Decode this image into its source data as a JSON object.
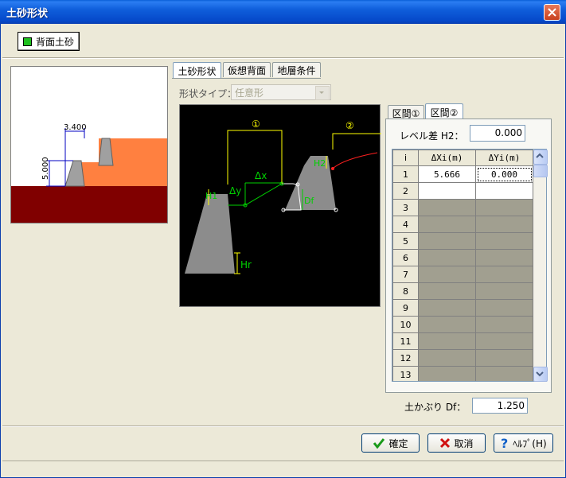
{
  "window": {
    "title": "土砂形状"
  },
  "layer_button": {
    "label": "背面土砂",
    "color": "#1ec01e"
  },
  "preview": {
    "dim_width": "3.400",
    "dim_height": "5.000"
  },
  "tabs": [
    {
      "label": "土砂形状",
      "active": true
    },
    {
      "label": "仮想背面",
      "active": false
    },
    {
      "label": "地層条件",
      "active": false
    }
  ],
  "shape_type": {
    "label": "形状タイプ：",
    "value": "任意形"
  },
  "diagram": {
    "section1": "①",
    "section2": "②",
    "dx": "Δx",
    "dy": "Δy",
    "h1": "H1",
    "h2": "H2",
    "df": "Df",
    "hr": "Hr"
  },
  "section_tabs": [
    {
      "label": "区間①",
      "active": false
    },
    {
      "label": "区間②",
      "active": true
    }
  ],
  "level_diff": {
    "label": "レベル差 H2：",
    "value": "0.000"
  },
  "table": {
    "headers": [
      "i",
      "ΔXi(m)",
      "ΔYi(m)"
    ],
    "rows": [
      {
        "i": "1",
        "dx": "5.666",
        "dy": "0.000"
      },
      {
        "i": "2",
        "dx": "",
        "dy": ""
      },
      {
        "i": "3",
        "dx": "",
        "dy": ""
      },
      {
        "i": "4",
        "dx": "",
        "dy": ""
      },
      {
        "i": "5",
        "dx": "",
        "dy": ""
      },
      {
        "i": "6",
        "dx": "",
        "dy": ""
      },
      {
        "i": "7",
        "dx": "",
        "dy": ""
      },
      {
        "i": "8",
        "dx": "",
        "dy": ""
      },
      {
        "i": "9",
        "dx": "",
        "dy": ""
      },
      {
        "i": "10",
        "dx": "",
        "dy": ""
      },
      {
        "i": "11",
        "dx": "",
        "dy": ""
      },
      {
        "i": "12",
        "dx": "",
        "dy": ""
      },
      {
        "i": "13",
        "dx": "",
        "dy": ""
      }
    ]
  },
  "cover_df": {
    "label": "土かぶり Df：",
    "value": "1.250"
  },
  "buttons": {
    "ok": "確定",
    "cancel": "取消",
    "help": "ﾍﾙﾌﾟ(H)"
  }
}
